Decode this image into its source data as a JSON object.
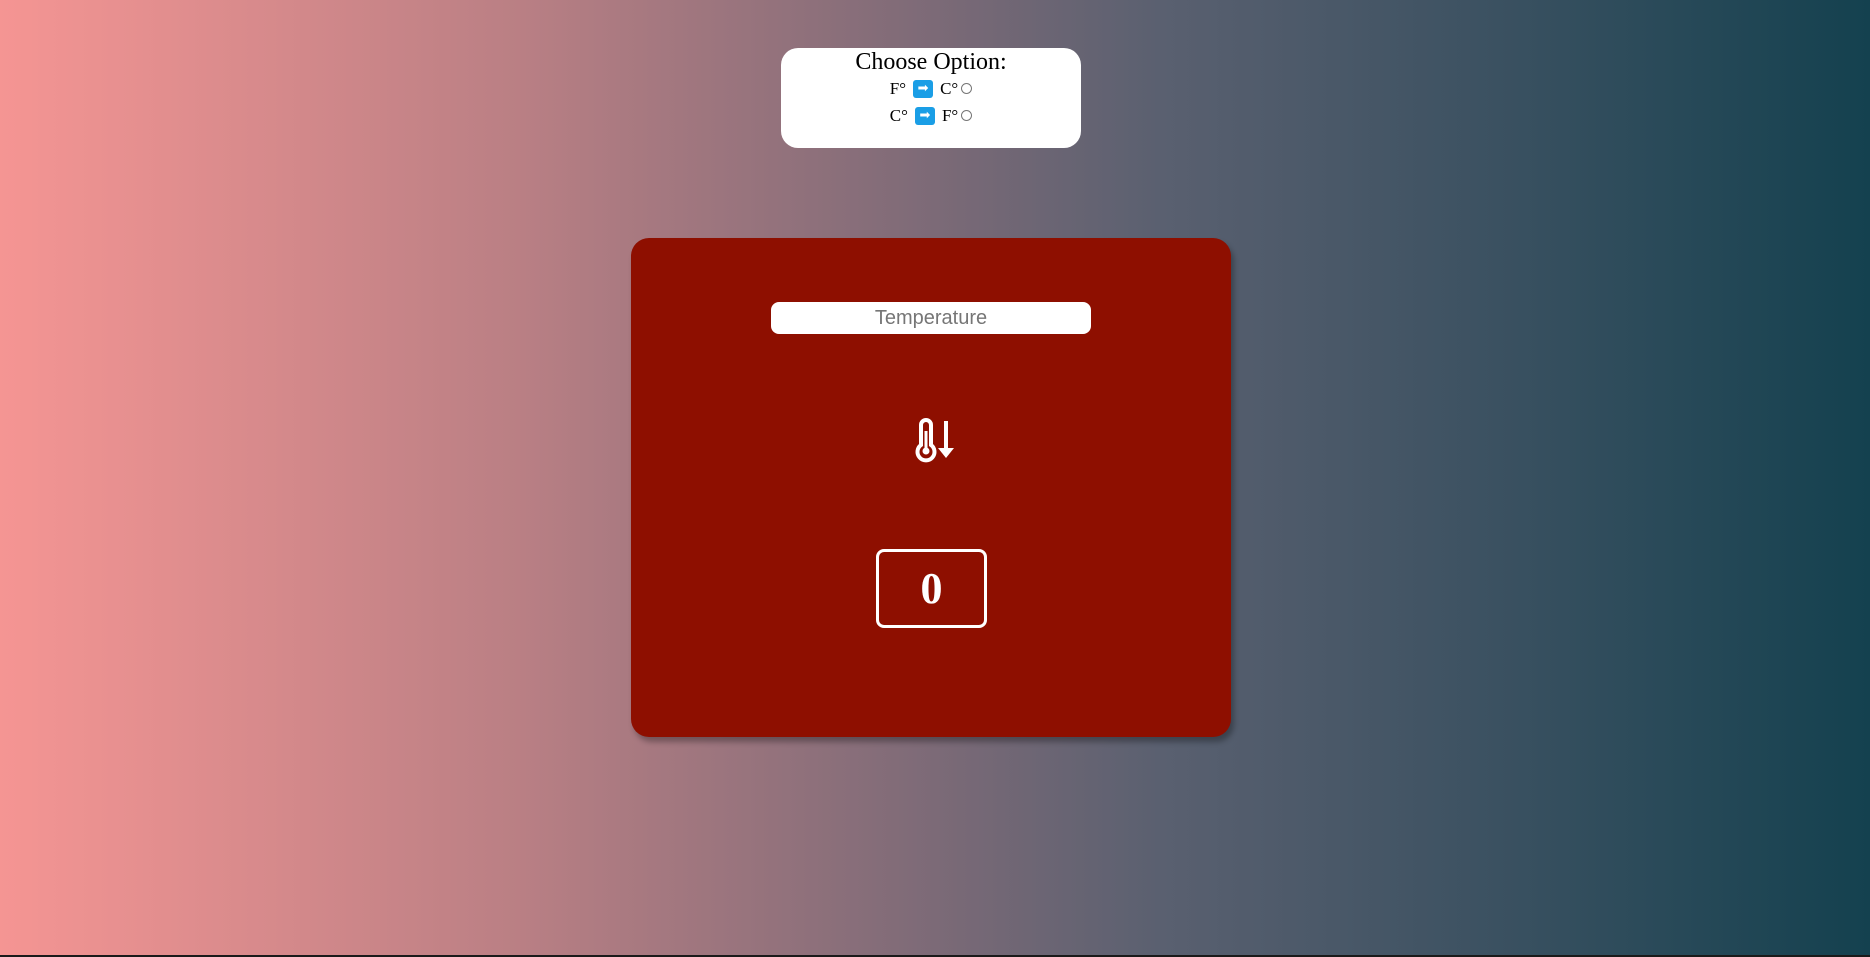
{
  "options": {
    "title": "Choose Option:",
    "items": [
      {
        "from": "F°",
        "arrow": "➡",
        "to": "C°",
        "selected": false
      },
      {
        "from": "C°",
        "arrow": "➡",
        "to": "F°",
        "selected": false
      }
    ]
  },
  "converter": {
    "input_placeholder": "Temperature",
    "input_value": "",
    "icon": "thermometer-arrow-down-icon",
    "result": "0"
  },
  "colors": {
    "card_background": "#8e0f00",
    "arrow_badge": "#1a9ee6",
    "gradient_start": "#f59593",
    "gradient_end": "#14414f"
  }
}
